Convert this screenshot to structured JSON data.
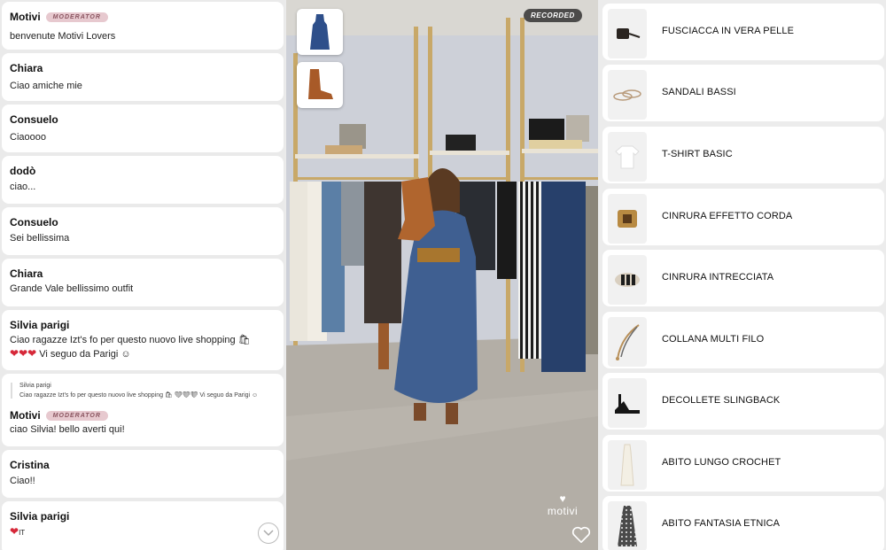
{
  "chat": {
    "messages": [
      {
        "author": "Motivi",
        "badge": "MODERATOR",
        "text": "benvenute Motivi Lovers"
      },
      {
        "author": "Chiara",
        "text": "Ciao amiche mie"
      },
      {
        "author": "Consuelo",
        "text": "Ciaoooo"
      },
      {
        "author": "dodò",
        "text": "ciao..."
      },
      {
        "author": "Consuelo",
        "text": "Sei bellissima"
      },
      {
        "author": "Chiara",
        "text": "Grande Vale bellissimo outfit"
      },
      {
        "author": "Silvia parigi",
        "text": "Ciao ragazze Izt's fo per questo nuovo live shopping 🛍",
        "text2": "Vi seguo da Parigi ☺"
      },
      {
        "quote_author": "Silvia parigi",
        "quote_text": "Ciao ragazze Izt's fo per questo nuovo live shopping 🛍 ❤❤❤ Vi seguo da Parigi ☺",
        "author": "Motivi",
        "badge": "MODERATOR",
        "text": "ciao Silvia! bello averti qui!"
      },
      {
        "author": "Cristina",
        "text": "Ciao!!"
      },
      {
        "author": "Silvia parigi",
        "text": "IT"
      }
    ],
    "scroll_icon": "chevron-down-icon"
  },
  "video": {
    "status": "RECORDED",
    "brand": "motivi",
    "thumbnails": [
      "blue-dress-thumbnail",
      "cowboy-boot-thumbnail"
    ],
    "like_icon": "heart-outline-icon"
  },
  "products": [
    {
      "name": "FUSCIACCA IN VERA PELLE",
      "icon": "belt-bag-icon"
    },
    {
      "name": "SANDALI BASSI",
      "icon": "sandals-icon"
    },
    {
      "name": "T-SHIRT BASIC",
      "icon": "tshirt-icon"
    },
    {
      "name": "CINRURA EFFETTO CORDA",
      "icon": "rope-belt-icon"
    },
    {
      "name": "CINRURA INTRECCIATA",
      "icon": "braided-belt-icon"
    },
    {
      "name": "COLLANA MULTI FILO",
      "icon": "necklace-icon"
    },
    {
      "name": "DECOLLETE SLINGBACK",
      "icon": "slingback-icon"
    },
    {
      "name": "ABITO LUNGO CROCHET",
      "icon": "crochet-dress-icon"
    },
    {
      "name": "ABITO FANTASIA ETNICA",
      "icon": "ethnic-dress-icon"
    }
  ],
  "colors": {
    "badge_bg": "#e7c9cf",
    "heart": "#d62839",
    "recorded_bg": "#323232"
  }
}
